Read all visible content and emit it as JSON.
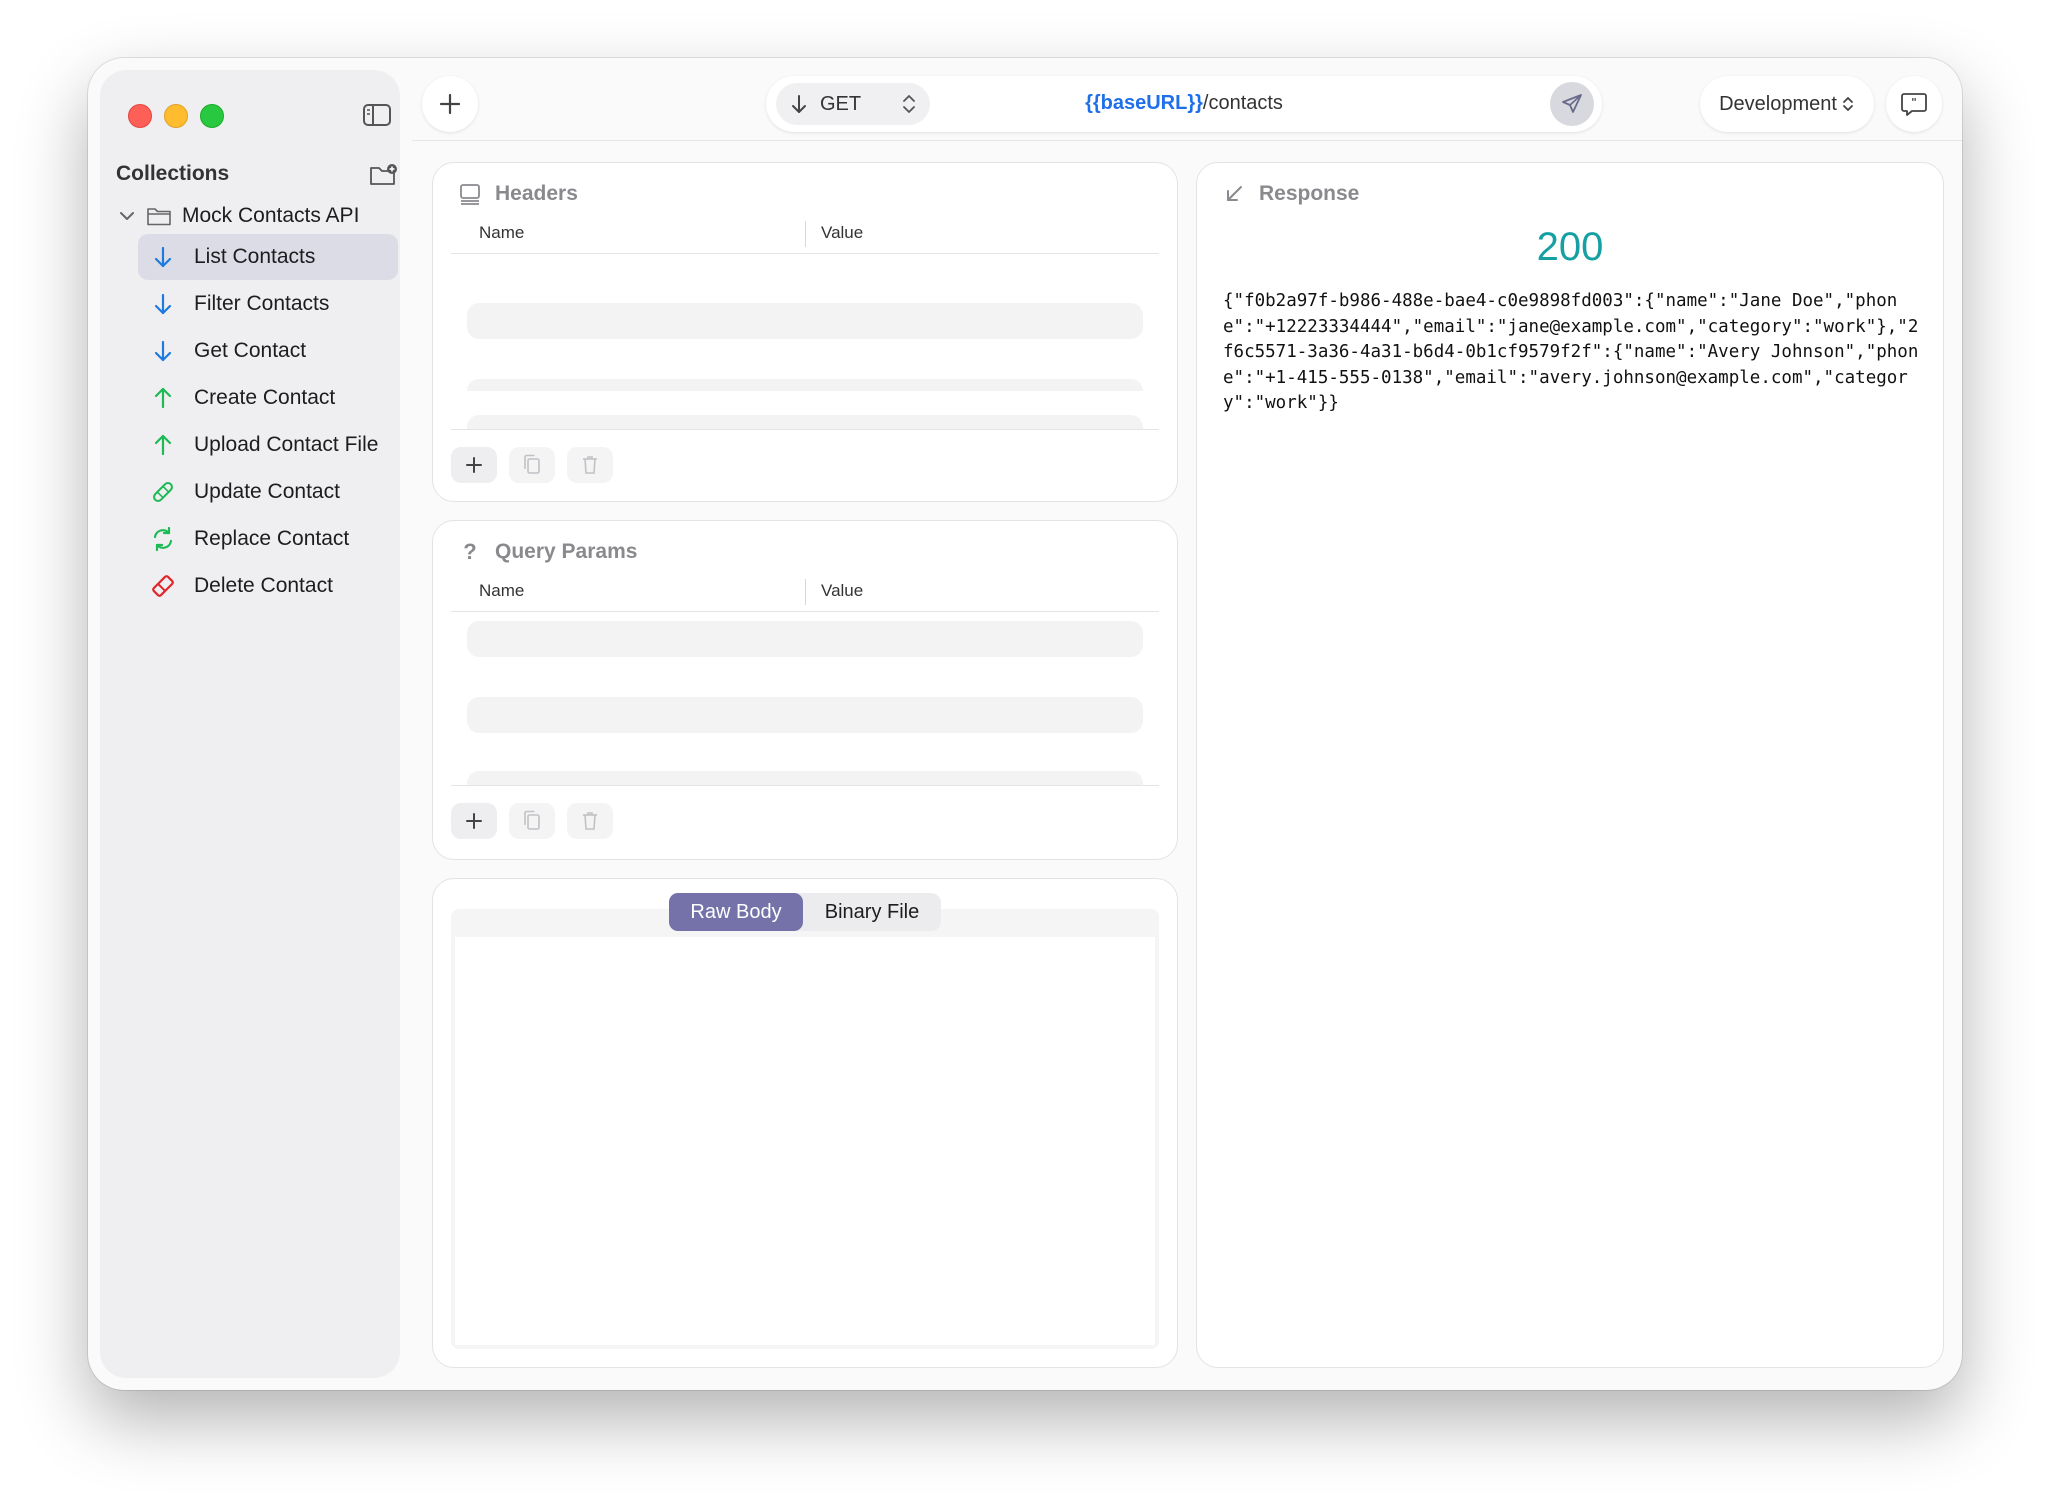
{
  "sidebar": {
    "collections_title": "Collections",
    "collection": {
      "name": "Mock Contacts API",
      "items": [
        {
          "label": "List Contacts",
          "icon": "arrow-down-icon",
          "color": "#1f7ae0",
          "selected": true
        },
        {
          "label": "Filter Contacts",
          "icon": "arrow-down-icon",
          "color": "#1f7ae0"
        },
        {
          "label": "Get Contact",
          "icon": "arrow-down-icon",
          "color": "#1f7ae0"
        },
        {
          "label": "Create Contact",
          "icon": "arrow-up-icon",
          "color": "#1db954"
        },
        {
          "label": "Upload Contact File",
          "icon": "arrow-up-icon",
          "color": "#1db954"
        },
        {
          "label": "Update Contact",
          "icon": "bandage-icon",
          "color": "#1db954"
        },
        {
          "label": "Replace Contact",
          "icon": "refresh-icon",
          "color": "#1db954"
        },
        {
          "label": "Delete Contact",
          "icon": "eraser-icon",
          "color": "#e0262d"
        }
      ]
    }
  },
  "toolbar": {
    "method": "GET",
    "url_variable": "{{baseURL}}",
    "url_path": "/contacts",
    "environment": "Development"
  },
  "headers": {
    "title": "Headers",
    "col_name": "Name",
    "col_value": "Value"
  },
  "query_params": {
    "title": "Query Params",
    "col_name": "Name",
    "col_value": "Value"
  },
  "body": {
    "tabs": [
      "Raw Body",
      "Binary File"
    ],
    "active_tab": "Raw Body"
  },
  "response": {
    "title": "Response",
    "status_code": "200",
    "status_color": "#16a0a4",
    "body_text": "{\"f0b2a97f-b986-488e-bae4-c0e9898fd003\":{\"name\":\"Jane Doe\",\"phone\":\"+12223334444\",\"email\":\"jane@example.com\",\"category\":\"work\"},\"2f6c5571-3a36-4a31-b6d4-0b1cf9579f2f\":{\"name\":\"Avery Johnson\",\"phone\":\"+1-415-555-0138\",\"email\":\"avery.johnson@example.com\",\"category\":\"work\"}}"
  }
}
